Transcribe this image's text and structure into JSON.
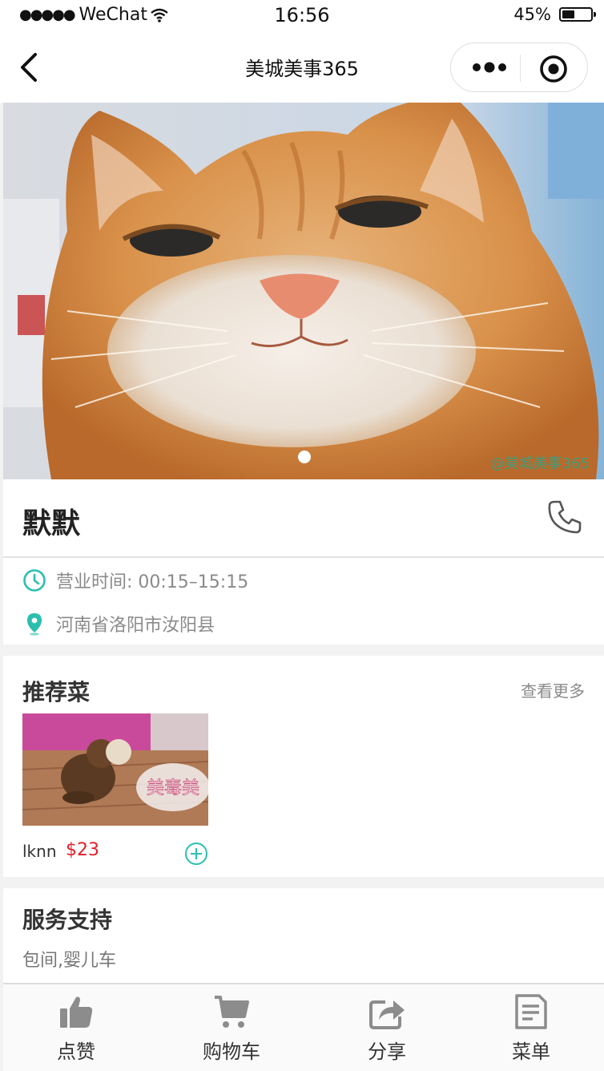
{
  "status_bar": {
    "carrier": "WeChat",
    "time": "16:56",
    "battery": "45%",
    "battery_level": 0.45
  },
  "nav": {
    "title": "美城美事365"
  },
  "banner": {
    "watermark": "@美城美事365",
    "slide_count": 1,
    "active_slide": 1
  },
  "shop": {
    "name": "默默",
    "hours": "营业时间: 00:15–15:15",
    "address": "河南省洛阳市汝阳县"
  },
  "recommend": {
    "title": "推荐菜",
    "more": "查看更多",
    "dishes": [
      {
        "name": "lknn",
        "price": "$23",
        "image_text": "美毒美"
      }
    ]
  },
  "services": {
    "title": "服务支持",
    "text": "包间,婴儿车"
  },
  "tabbar": {
    "items": [
      {
        "label": "点赞",
        "icon": "thumbs-up-icon"
      },
      {
        "label": "购物车",
        "icon": "cart-icon"
      },
      {
        "label": "分享",
        "icon": "share-icon"
      },
      {
        "label": "菜单",
        "icon": "menu-list-icon"
      }
    ]
  },
  "colors": {
    "accent": "#2bbfae",
    "price": "#e0202a"
  }
}
